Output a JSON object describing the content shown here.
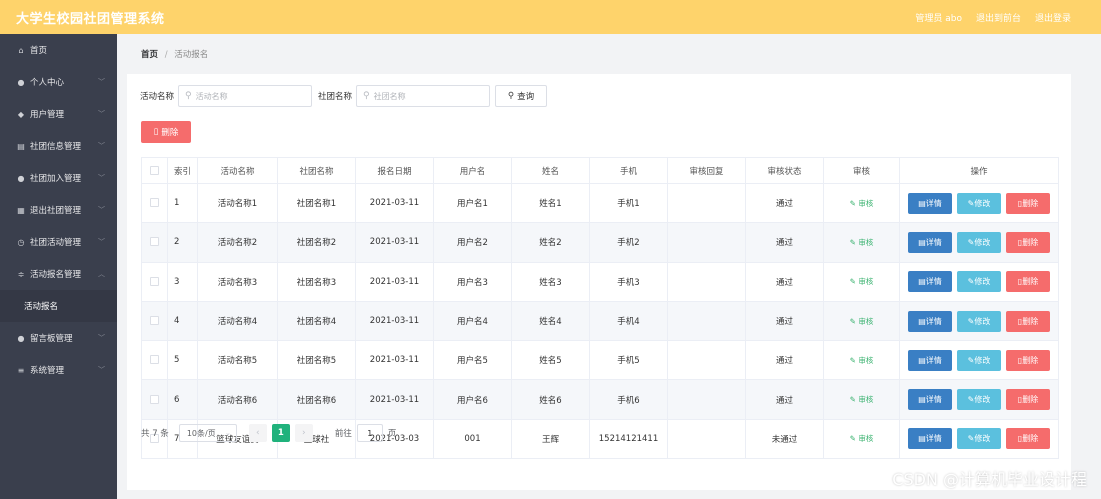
{
  "header": {
    "title": "大学生校园社团管理系统",
    "links": [
      "管理员 abo",
      "退出到前台",
      "退出登录"
    ]
  },
  "sidebar": {
    "items": [
      {
        "label": "首页",
        "icon": "home-icon",
        "glyph": "⌂",
        "has_chevron": false
      },
      {
        "label": "个人中心",
        "icon": "user-icon",
        "glyph": "●",
        "has_chevron": true
      },
      {
        "label": "用户管理",
        "icon": "location-icon",
        "glyph": "◆",
        "has_chevron": true
      },
      {
        "label": "社团信息管理",
        "icon": "document-icon",
        "glyph": "▤",
        "has_chevron": true
      },
      {
        "label": "社团加入管理",
        "icon": "user-add-icon",
        "glyph": "●",
        "has_chevron": true
      },
      {
        "label": "退出社团管理",
        "icon": "grid-icon",
        "glyph": "▦",
        "has_chevron": true
      },
      {
        "label": "社团活动管理",
        "icon": "clock-icon",
        "glyph": "◷",
        "has_chevron": true
      },
      {
        "label": "活动报名管理",
        "icon": "sliders-icon",
        "glyph": "≑",
        "has_chevron": true,
        "expanded": true
      },
      {
        "label": "留言板管理",
        "icon": "user-icon",
        "glyph": "●",
        "has_chevron": true
      },
      {
        "label": "系统管理",
        "icon": "menu-icon",
        "glyph": "≡",
        "has_chevron": true
      }
    ],
    "sub_item": "活动报名"
  },
  "breadcrumb": {
    "home": "首页",
    "sep": "/",
    "current": "活动报名"
  },
  "search": {
    "activity_label": "活动名称",
    "activity_placeholder": "活动名称",
    "club_label": "社团名称",
    "club_placeholder": "社团名称",
    "query_button": "查询"
  },
  "actions": {
    "delete_button": "删除"
  },
  "table": {
    "headers": [
      "索引",
      "活动名称",
      "社团名称",
      "报名日期",
      "用户名",
      "姓名",
      "手机",
      "审核回复",
      "审核状态",
      "审核",
      "操作"
    ],
    "audit_label": "审核",
    "op_labels": {
      "detail": "详情",
      "edit": "修改",
      "delete": "删除"
    },
    "rows": [
      {
        "index": "1",
        "activity": "活动名称1",
        "club": "社团名称1",
        "date": "2021-03-11",
        "username": "用户名1",
        "name": "姓名1",
        "phone": "手机1",
        "reply": "",
        "status": "通过"
      },
      {
        "index": "2",
        "activity": "活动名称2",
        "club": "社团名称2",
        "date": "2021-03-11",
        "username": "用户名2",
        "name": "姓名2",
        "phone": "手机2",
        "reply": "",
        "status": "通过"
      },
      {
        "index": "3",
        "activity": "活动名称3",
        "club": "社团名称3",
        "date": "2021-03-11",
        "username": "用户名3",
        "name": "姓名3",
        "phone": "手机3",
        "reply": "",
        "status": "通过"
      },
      {
        "index": "4",
        "activity": "活动名称4",
        "club": "社团名称4",
        "date": "2021-03-11",
        "username": "用户名4",
        "name": "姓名4",
        "phone": "手机4",
        "reply": "",
        "status": "通过"
      },
      {
        "index": "5",
        "activity": "活动名称5",
        "club": "社团名称5",
        "date": "2021-03-11",
        "username": "用户名5",
        "name": "姓名5",
        "phone": "手机5",
        "reply": "",
        "status": "通过"
      },
      {
        "index": "6",
        "activity": "活动名称6",
        "club": "社团名称6",
        "date": "2021-03-11",
        "username": "用户名6",
        "name": "姓名6",
        "phone": "手机6",
        "reply": "",
        "status": "通过"
      },
      {
        "index": "7",
        "activity": "篮球友谊赛",
        "club": "篮球社",
        "date": "2021-03-03",
        "username": "001",
        "name": "王辉",
        "phone": "15214121411",
        "reply": "",
        "status": "未通过"
      }
    ]
  },
  "pagination": {
    "total": "共 7 条",
    "page_size": "10条/页",
    "current_page": "1",
    "goto_prefix": "前往",
    "goto_value": "1",
    "goto_suffix": "页"
  },
  "watermark": "CSDN @计算机毕业设计程",
  "colors": {
    "topbar": "#fed36b",
    "sidebar": "#3a3f4d",
    "danger": "#f56c6c",
    "primary": "#3a7fc4",
    "info": "#5bc0de",
    "success": "#20b27c"
  }
}
